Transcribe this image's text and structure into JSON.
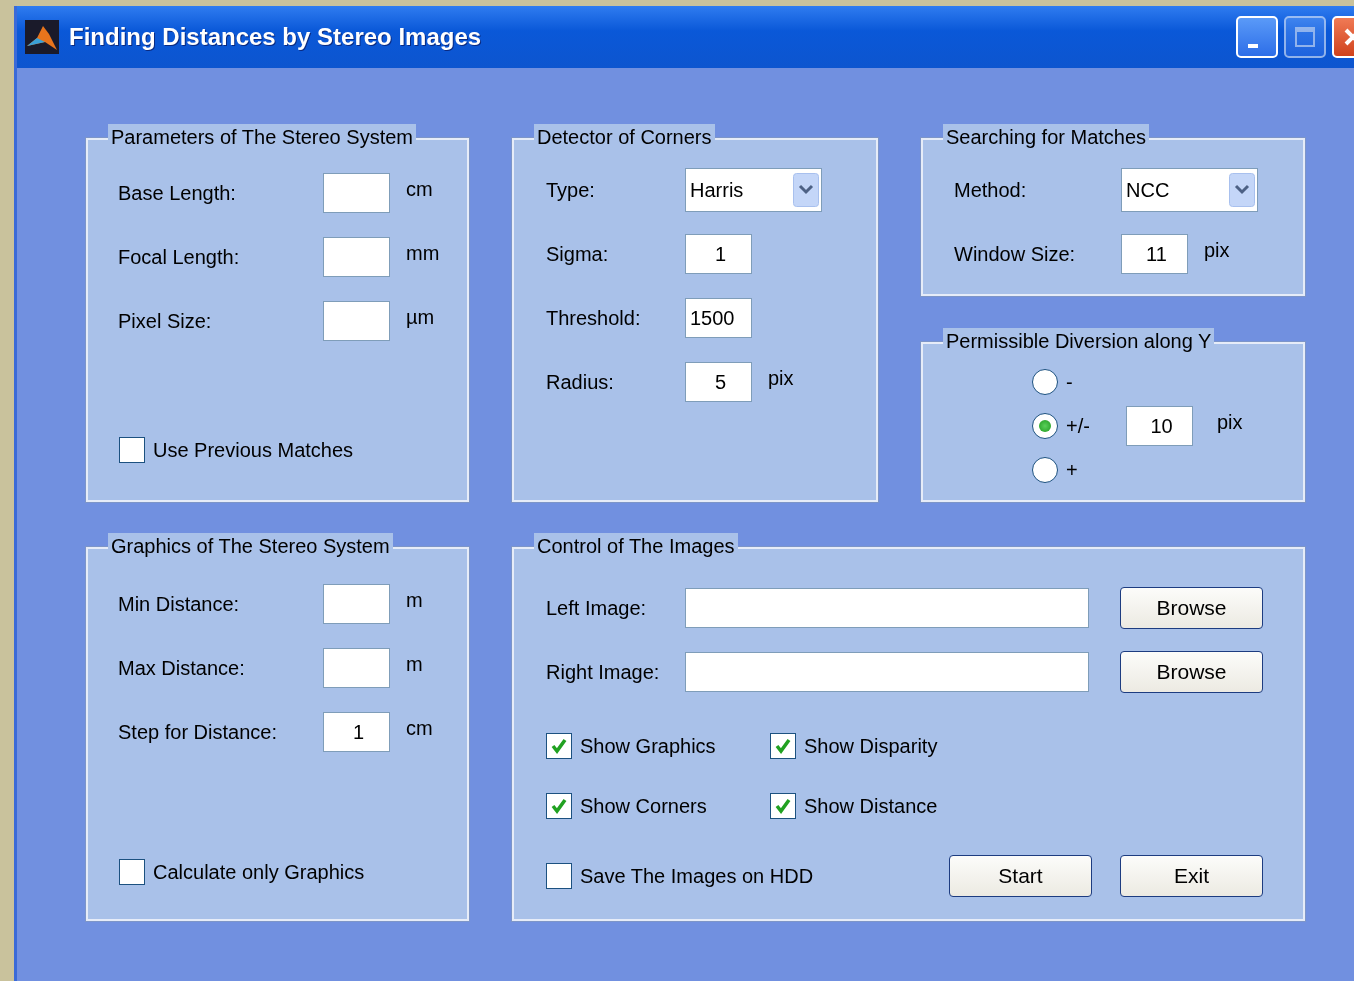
{
  "window": {
    "title": "Finding Distances by Stereo Images"
  },
  "stereo_parameters": {
    "title": "Parameters of The Stereo System",
    "fields": [
      {
        "kind": "input",
        "label": "Base Length:",
        "unit": "cm"
      },
      {
        "kind": "input",
        "label": "Focal Length:",
        "unit": "mm"
      },
      {
        "kind": "input",
        "label": "Pixel Size:",
        "unit": "µm"
      }
    ],
    "option": {
      "label": "Use Previous Matches",
      "checked": false
    }
  },
  "corner_detector": {
    "title": "Detector of Corners",
    "fields": [
      {
        "kind": "select",
        "label": "Type:",
        "value": "Harris"
      },
      {
        "kind": "input",
        "label": "Sigma:",
        "value": "1"
      },
      {
        "kind": "input",
        "label": "Threshold:",
        "value": "1500"
      },
      {
        "kind": "input",
        "label": "Radius:",
        "value": "5",
        "unit": "pix"
      }
    ]
  },
  "match_search": {
    "title": "Searching for Matches",
    "fields": [
      {
        "kind": "select",
        "label": "Method:",
        "value": "NCC"
      },
      {
        "kind": "input",
        "label": "Window Size:",
        "value": "11",
        "unit": "pix"
      }
    ]
  },
  "y_diversion": {
    "title": "Permissible Diversion along Y",
    "options": [
      {
        "label": "-",
        "selected": false
      },
      {
        "label": "+/-",
        "selected": true
      },
      {
        "label": "+",
        "selected": false
      }
    ],
    "value": "10",
    "unit": "pix"
  },
  "stereo_graphics": {
    "title": "Graphics of The Stereo System",
    "fields": [
      {
        "kind": "input",
        "label": "Min Distance:",
        "unit": "m"
      },
      {
        "kind": "input",
        "label": "Max Distance:",
        "unit": "m"
      },
      {
        "kind": "input",
        "label": "Step for Distance:",
        "value": "1",
        "unit": "cm"
      }
    ],
    "option": {
      "label": "Calculate only Graphics",
      "checked": false
    }
  },
  "image_control": {
    "title": "Control of The Images",
    "files": [
      {
        "label": "Left Image:",
        "button": "Browse"
      },
      {
        "label": "Right Image:",
        "button": "Browse"
      }
    ],
    "options": [
      {
        "label": "Show Graphics",
        "checked": true
      },
      {
        "label": "Show Disparity",
        "checked": true
      },
      {
        "label": "Show Corners",
        "checked": true
      },
      {
        "label": "Show Distance",
        "checked": true
      },
      {
        "label": "Save The Images on HDD",
        "checked": false
      }
    ],
    "buttons": [
      "Start",
      "Exit"
    ]
  }
}
